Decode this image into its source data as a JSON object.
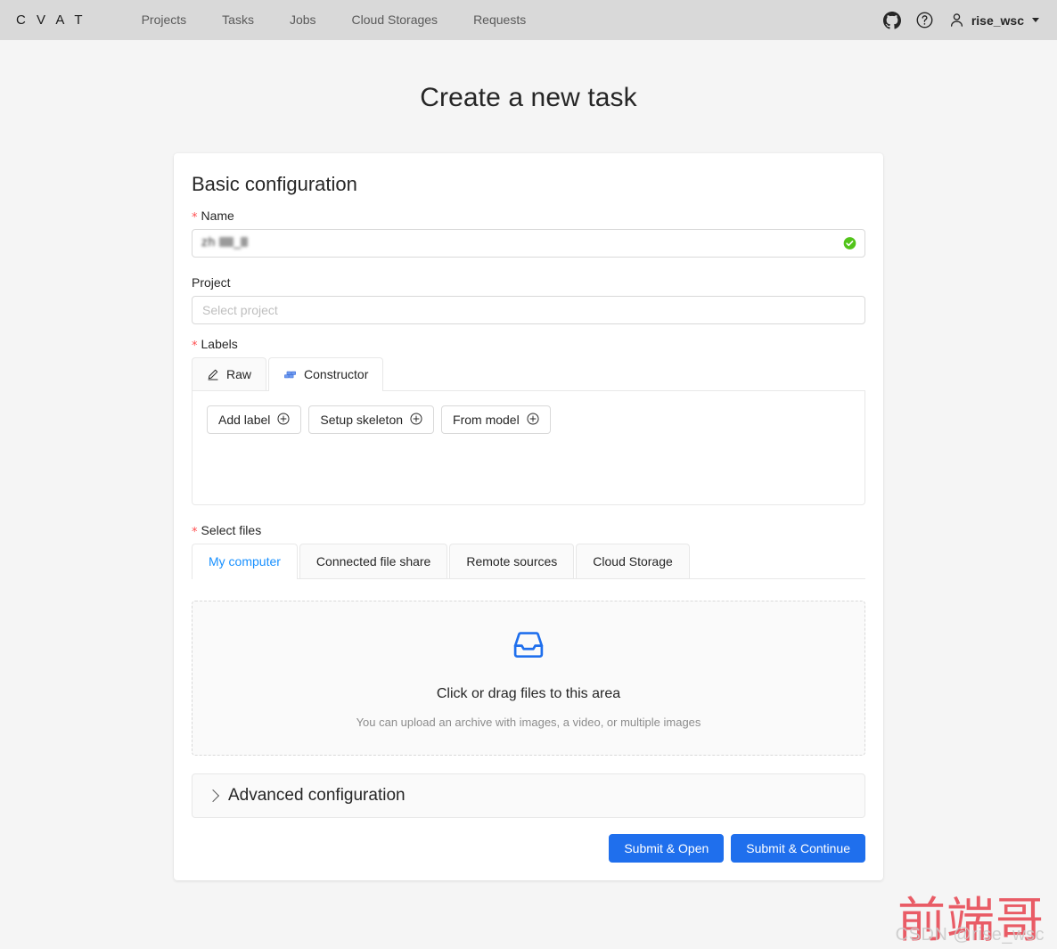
{
  "header": {
    "logo": "C V A T",
    "nav": [
      {
        "label": "Projects",
        "name": "nav-projects"
      },
      {
        "label": "Tasks",
        "name": "nav-tasks"
      },
      {
        "label": "Jobs",
        "name": "nav-jobs"
      },
      {
        "label": "Cloud Storages",
        "name": "nav-cloud-storages"
      },
      {
        "label": "Requests",
        "name": "nav-requests"
      }
    ],
    "github_icon": "github-icon",
    "help_icon": "question-circle-icon",
    "user_icon": "user-avatar-icon",
    "username": "rise_wsc",
    "caret_icon": "chevron-down-icon"
  },
  "page": {
    "title": "Create a new task"
  },
  "card": {
    "title": "Basic configuration"
  },
  "name_field": {
    "label": "Name",
    "required": true,
    "value": "zh",
    "placeholder": "",
    "validation_icon": "check-circle-icon",
    "validation_color": "#52c41a"
  },
  "project_field": {
    "label": "Project",
    "required": false,
    "placeholder": "Select project",
    "value": ""
  },
  "labels_section": {
    "label": "Labels",
    "required": true,
    "tabs": [
      {
        "label": "Raw",
        "icon": "edit-pencil-icon",
        "active": false
      },
      {
        "label": "Constructor",
        "icon": "build-blocks-icon",
        "active": true
      }
    ],
    "buttons": [
      {
        "label": "Add label",
        "icon": "plus-circle-icon"
      },
      {
        "label": "Setup skeleton",
        "icon": "plus-circle-icon"
      },
      {
        "label": "From model",
        "icon": "plus-circle-icon"
      }
    ]
  },
  "files_section": {
    "label": "Select files",
    "required": true,
    "tabs": [
      {
        "label": "My computer",
        "active": true
      },
      {
        "label": "Connected file share",
        "active": false
      },
      {
        "label": "Remote sources",
        "active": false
      },
      {
        "label": "Cloud Storage",
        "active": false
      }
    ],
    "dropzone": {
      "icon": "inbox-icon",
      "icon_color": "#1f6fed",
      "title": "Click or drag files to this area",
      "hint": "You can upload an archive with images, a video, or multiple images"
    }
  },
  "advanced": {
    "title": "Advanced configuration",
    "expanded": false,
    "chevron_icon": "chevron-right-icon"
  },
  "actions": {
    "submit_open": "Submit & Open",
    "submit_continue": "Submit & Continue",
    "primary_color": "#1f6fed"
  },
  "watermark": {
    "main": "前端哥",
    "sub": "CSDN @rise_wsc",
    "main_color": "#e8505a"
  }
}
